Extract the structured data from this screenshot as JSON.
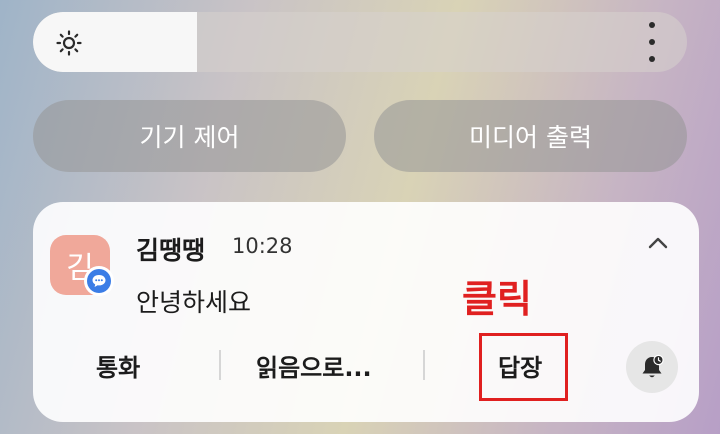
{
  "brightness": {
    "level": 0.25
  },
  "quick_buttons": {
    "device_control": "기기 제어",
    "media_output": "미디어 출력"
  },
  "notification": {
    "avatar_char": "김",
    "sender": "김땡땡",
    "time": "10:28",
    "message": "안녕하세요",
    "actions": {
      "call": "통화",
      "mark_read": "읽음으로...",
      "reply": "답장"
    }
  },
  "annotation": {
    "click_label": "클릭",
    "color": "#e02020"
  },
  "colors": {
    "accent_blue": "#3b7de6",
    "avatar_bg": "#f0a89a"
  }
}
